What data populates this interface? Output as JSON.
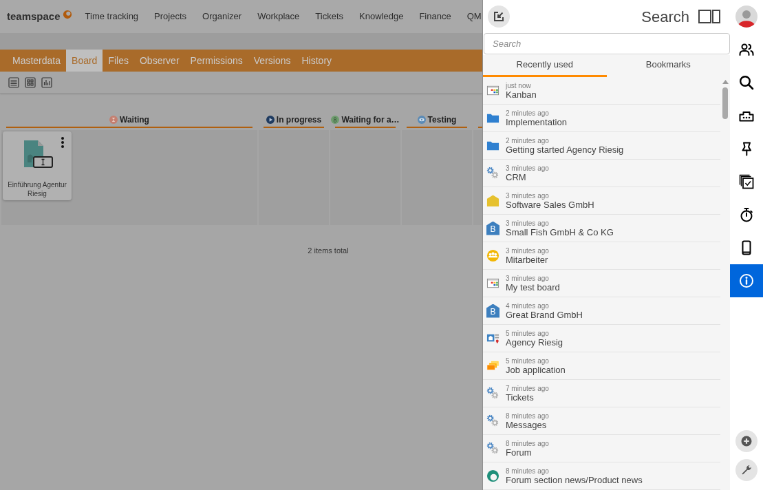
{
  "app": {
    "logo": "teamspace",
    "nav": [
      "Time tracking",
      "Projects",
      "Organizer",
      "Workplace",
      "Tickets",
      "Knowledge",
      "Finance",
      "QM"
    ],
    "tabs": [
      {
        "label": "Masterdata",
        "selected": false
      },
      {
        "label": "Board",
        "selected": true
      },
      {
        "label": "Files",
        "selected": false
      },
      {
        "label": "Observer",
        "selected": false
      },
      {
        "label": "Permissions",
        "selected": false
      },
      {
        "label": "Versions",
        "selected": false
      },
      {
        "label": "History",
        "selected": false
      }
    ],
    "board": {
      "columns": [
        {
          "kind": "hourglass",
          "title": "Waiting",
          "color": "#c47f70",
          "cards": [
            {
              "title": "Einführung Agentur Riesig"
            }
          ]
        },
        {
          "kind": "play",
          "title": "In progress",
          "color": "#1f3b60"
        },
        {
          "kind": "person",
          "title": "Waiting for a…",
          "color": "#6f9d6f"
        },
        {
          "kind": "eye",
          "title": "Testing",
          "color": "#5b8bb6"
        }
      ],
      "total": "2 items total"
    }
  },
  "search_panel": {
    "title": "Search",
    "search": {
      "placeholder": "Search"
    },
    "tabs": [
      {
        "label": "Recently used",
        "selected": true
      },
      {
        "label": "Bookmarks",
        "selected": false
      }
    ],
    "items": [
      {
        "kind": "board",
        "time": "just now",
        "title": "Kanban"
      },
      {
        "kind": "folder",
        "time": "2 minutes ago",
        "title": "Implementation"
      },
      {
        "kind": "folder",
        "time": "2 minutes ago",
        "title": "Getting started Agency Riesig"
      },
      {
        "kind": "gears",
        "time": "3 minutes ago",
        "title": "CRM"
      },
      {
        "kind": "company",
        "time": "3 minutes ago",
        "title": "Software Sales GmbH"
      },
      {
        "kind": "brand",
        "letter": "B",
        "time": "3 minutes ago",
        "title": "Small Fish GmbH & Co KG"
      },
      {
        "kind": "team",
        "time": "3 minutes ago",
        "title": "Mitarbeiter"
      },
      {
        "kind": "board",
        "time": "3 minutes ago",
        "title": "My test board"
      },
      {
        "kind": "brand",
        "letter": "B",
        "time": "4 minutes ago",
        "title": "Great Brand GmbH"
      },
      {
        "kind": "address",
        "time": "5 minutes ago",
        "title": "Agency Riesig"
      },
      {
        "kind": "stack",
        "time": "5 minutes ago",
        "title": "Job application"
      },
      {
        "kind": "gears",
        "time": "7 minutes ago",
        "title": "Tickets"
      },
      {
        "kind": "gears",
        "time": "8 minutes ago",
        "title": "Messages"
      },
      {
        "kind": "gears",
        "time": "8 minutes ago",
        "title": "Forum"
      },
      {
        "kind": "forum",
        "time": "8 minutes ago",
        "title": "Forum section news/Product news"
      }
    ]
  },
  "sidebar": {
    "items": [
      {
        "kind": "people",
        "selected": false
      },
      {
        "kind": "search",
        "selected": false
      },
      {
        "kind": "ticket",
        "selected": false
      },
      {
        "kind": "pin",
        "selected": false
      },
      {
        "kind": "checklist",
        "selected": false
      },
      {
        "kind": "stopwatch",
        "selected": false
      },
      {
        "kind": "phone",
        "selected": false
      },
      {
        "kind": "info",
        "selected": true
      }
    ],
    "bottom": [
      {
        "kind": "add"
      },
      {
        "kind": "wrench"
      }
    ]
  }
}
